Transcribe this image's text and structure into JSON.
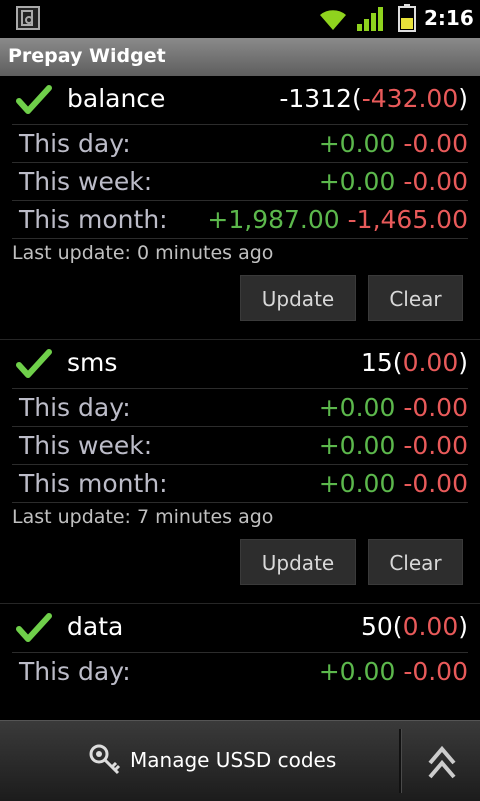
{
  "status": {
    "time": "2:16"
  },
  "title": "Prepay Widget",
  "sections": [
    {
      "name": "balance",
      "value": "-1312",
      "diff": "-432.00",
      "rows": [
        {
          "label": "This day:",
          "pos": "+0.00",
          "neg": "-0.00"
        },
        {
          "label": "This week:",
          "pos": "+0.00",
          "neg": "-0.00"
        },
        {
          "label": "This month:",
          "pos": "+1,987.00",
          "neg": "-1,465.00"
        }
      ],
      "last_update": "Last update: 0 minutes ago",
      "update_label": "Update",
      "clear_label": "Clear"
    },
    {
      "name": "sms",
      "value": "15",
      "diff": "0.00",
      "rows": [
        {
          "label": "This day:",
          "pos": "+0.00",
          "neg": "-0.00"
        },
        {
          "label": "This week:",
          "pos": "+0.00",
          "neg": "-0.00"
        },
        {
          "label": "This month:",
          "pos": "+0.00",
          "neg": "-0.00"
        }
      ],
      "last_update": "Last update: 7 minutes ago",
      "update_label": "Update",
      "clear_label": "Clear"
    },
    {
      "name": "data",
      "value": "50",
      "diff": "0.00",
      "rows": [
        {
          "label": "This day:",
          "pos": "+0.00",
          "neg": "-0.00"
        }
      ]
    }
  ],
  "bottom": {
    "manage_label": "Manage USSD codes"
  },
  "colors": {
    "positive": "#5cb84c",
    "negative": "#e85a5a",
    "label": "#bcbcc8"
  },
  "icons": [
    "app-icon",
    "wifi-icon",
    "signal-icon",
    "battery-icon",
    "checkmark-icon",
    "key-settings-icon",
    "double-chevron-up-icon"
  ]
}
